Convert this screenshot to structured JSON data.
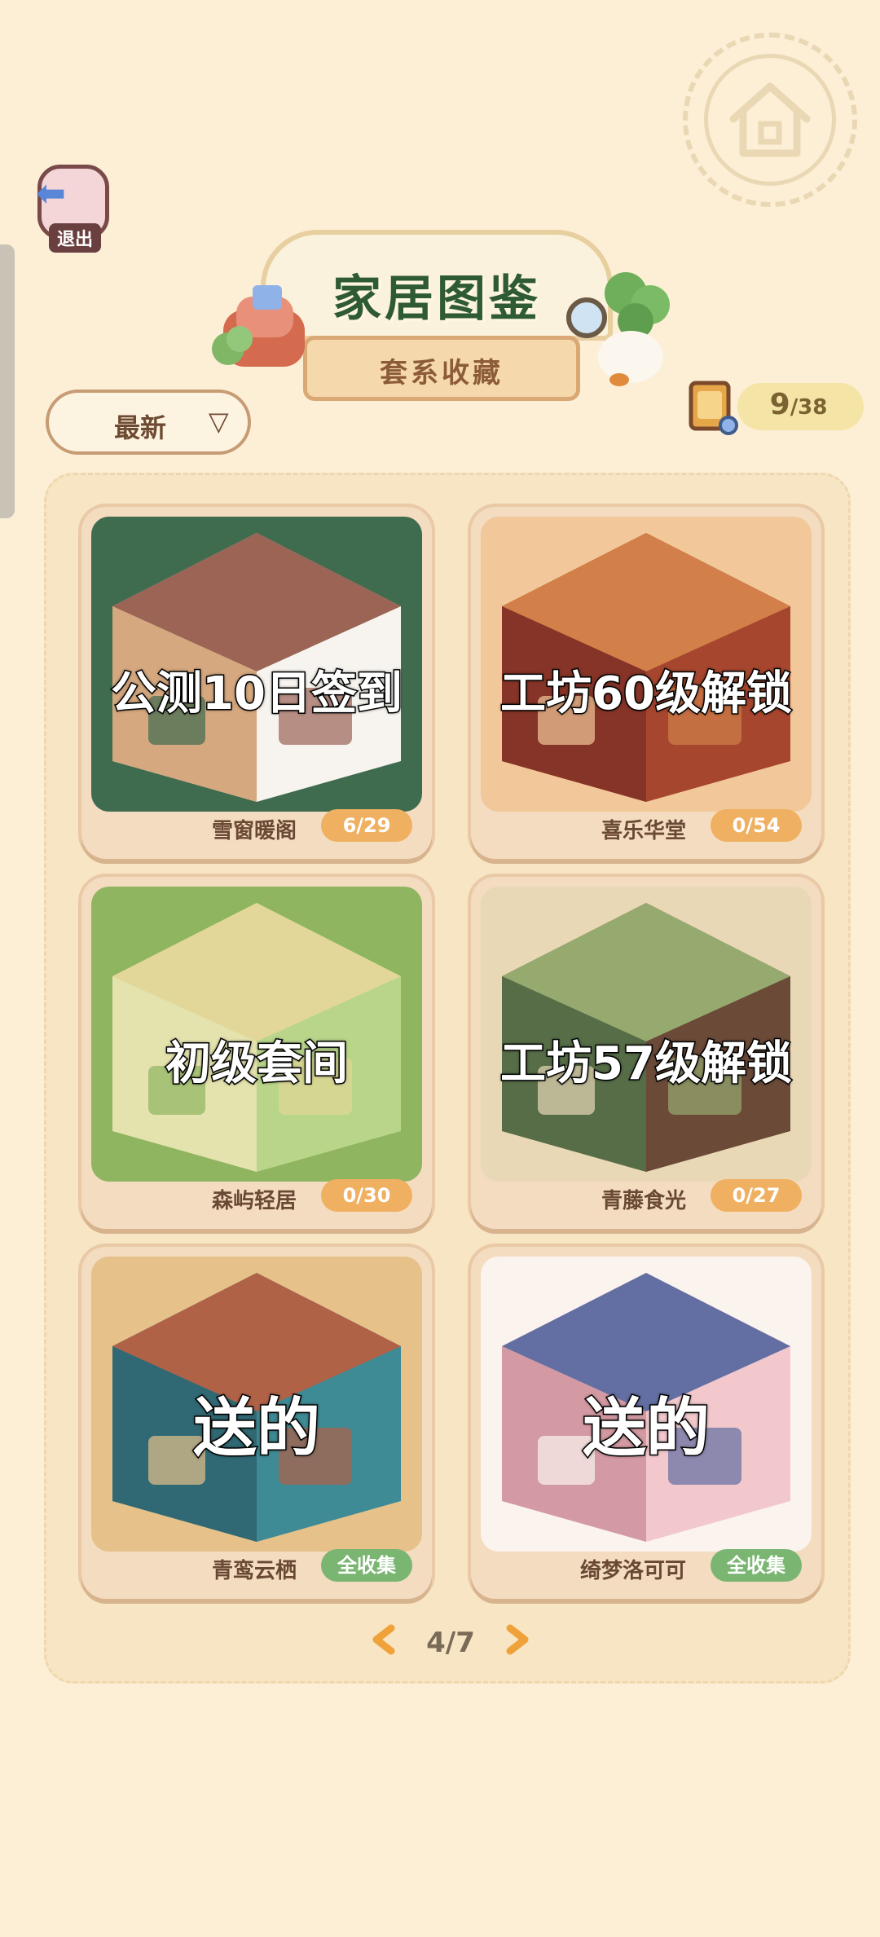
{
  "exit": {
    "label": "退出"
  },
  "title": {
    "main": "家居图鉴",
    "subtitle": "套系收藏"
  },
  "sort": {
    "selected": "最新"
  },
  "counter": {
    "collected": "9",
    "total": "/38"
  },
  "cards": [
    {
      "caption": "公测10日签到",
      "name": "雪窗暖阁",
      "progress": "6/29",
      "scene_colors": [
        "#f7f4ef",
        "#8b4a3a",
        "#3f6b4f",
        "#c98f5a"
      ]
    },
    {
      "caption": "工坊60级解锁",
      "name": "喜乐华堂",
      "progress": "0/54",
      "scene_colors": [
        "#a6462e",
        "#d98a4e",
        "#f2c89a",
        "#7b2f25"
      ]
    },
    {
      "caption": "初级套间",
      "name": "森屿轻居",
      "progress": "0/30",
      "scene_colors": [
        "#b9d58a",
        "#e9d79a",
        "#8fb560",
        "#f3e6b8"
      ]
    },
    {
      "caption": "工坊57级解锁",
      "name": "青藤食光",
      "progress": "0/27",
      "scene_colors": [
        "#6b4a38",
        "#9dbb7a",
        "#e8d8b6",
        "#4f7a4c"
      ]
    },
    {
      "caption": "送的",
      "name": "青鸾云栖",
      "progress": "全收集",
      "scene_colors": [
        "#3e8a95",
        "#c45a3a",
        "#e6c18a",
        "#2c5e6a"
      ]
    },
    {
      "caption": "送的",
      "name": "绮梦洛可可",
      "progress": "全收集",
      "scene_colors": [
        "#f2c8cc",
        "#4a5e9a",
        "#fbf3ee",
        "#c98b96"
      ]
    }
  ],
  "pagination": {
    "page": "4/7"
  },
  "colors": {
    "background": "#fcefd6",
    "title_green": "#2f5b32",
    "badge_orange": "#f0b061",
    "badge_green": "#7ab672"
  }
}
